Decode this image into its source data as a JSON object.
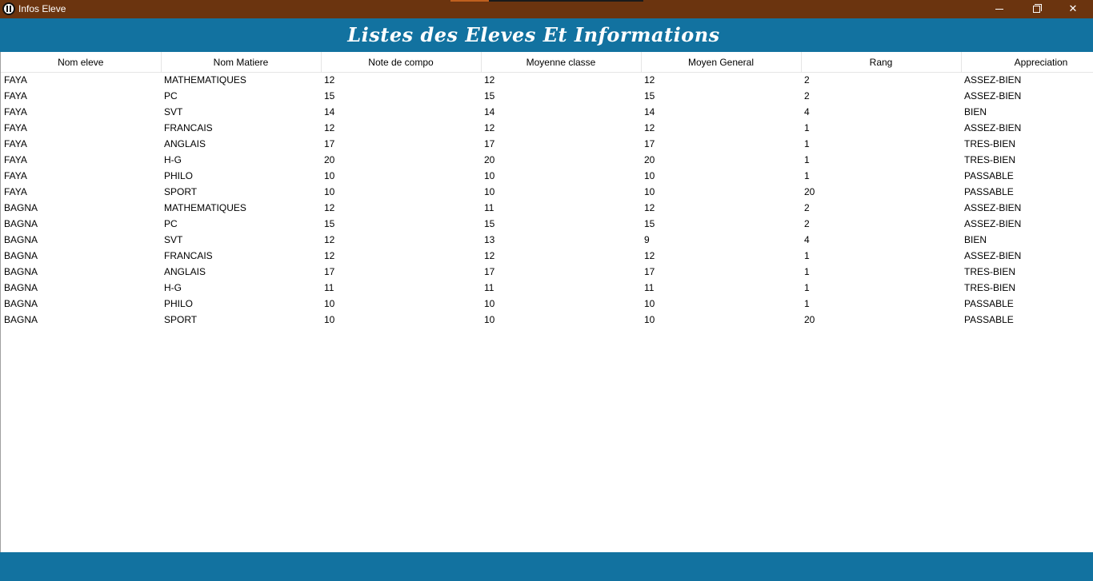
{
  "window": {
    "title": "Infos Eleve"
  },
  "header": {
    "title": "Listes des Eleves Et Informations"
  },
  "table": {
    "columns": [
      "Nom eleve",
      "Nom Matiere",
      "Note de compo",
      "Moyenne classe",
      "Moyen General",
      "Rang",
      "Appreciation"
    ],
    "rows": [
      [
        "FAYA",
        "MATHEMATIQUES",
        "12",
        "12",
        "12",
        "2",
        "ASSEZ-BIEN"
      ],
      [
        "FAYA",
        "PC",
        "15",
        "15",
        "15",
        "2",
        "ASSEZ-BIEN"
      ],
      [
        "FAYA",
        "SVT",
        "14",
        "14",
        "14",
        "4",
        "BIEN"
      ],
      [
        "FAYA",
        "FRANCAIS",
        "12",
        "12",
        "12",
        "1",
        "ASSEZ-BIEN"
      ],
      [
        "FAYA",
        "ANGLAIS",
        "17",
        "17",
        "17",
        "1",
        "TRES-BIEN"
      ],
      [
        "FAYA",
        "H-G",
        "20",
        "20",
        "20",
        "1",
        "TRES-BIEN"
      ],
      [
        "FAYA",
        "PHILO",
        "10",
        "10",
        "10",
        "1",
        "PASSABLE"
      ],
      [
        "FAYA",
        "SPORT",
        "10",
        "10",
        "10",
        "20",
        "PASSABLE"
      ],
      [
        "BAGNA",
        "MATHEMATIQUES",
        "12",
        "11",
        "12",
        "2",
        "ASSEZ-BIEN"
      ],
      [
        "BAGNA",
        "PC",
        "15",
        "15",
        "15",
        "2",
        "ASSEZ-BIEN"
      ],
      [
        "BAGNA",
        "SVT",
        "12",
        "13",
        "9",
        "4",
        "BIEN"
      ],
      [
        "BAGNA",
        "FRANCAIS",
        "12",
        "12",
        "12",
        "1",
        "ASSEZ-BIEN"
      ],
      [
        "BAGNA",
        "ANGLAIS",
        "17",
        "17",
        "17",
        "1",
        "TRES-BIEN"
      ],
      [
        "BAGNA",
        "H-G",
        "11",
        "11",
        "11",
        "1",
        "TRES-BIEN"
      ],
      [
        "BAGNA",
        "PHILO",
        "10",
        "10",
        "10",
        "1",
        "PASSABLE"
      ],
      [
        "BAGNA",
        "SPORT",
        "10",
        "10",
        "10",
        "20",
        "PASSABLE"
      ]
    ]
  },
  "colors": {
    "titlebar": "#6b340f",
    "accent": "#1272a0"
  },
  "icons": {
    "app": "app-icon",
    "minimize": "minimize-icon",
    "maximize": "restore-icon",
    "close": "close-icon"
  }
}
